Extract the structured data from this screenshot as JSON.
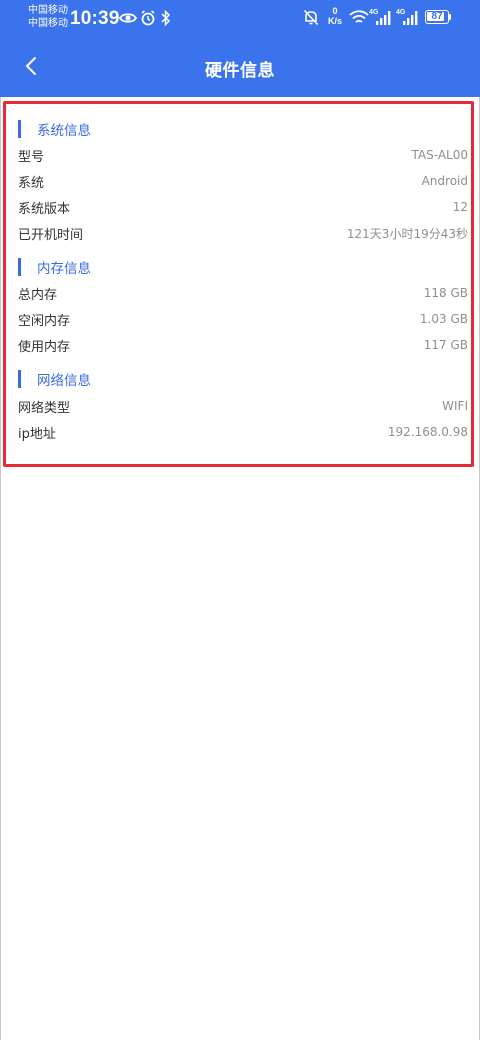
{
  "status_bar": {
    "carrier_1": "中国移动",
    "carrier_2": "中国移动",
    "time": "10:39",
    "net_speed_value": "0",
    "net_speed_unit": "K/s",
    "signal_1_label": "4G",
    "signal_2_label": "4G",
    "battery": "87",
    "battery_level": 0.87,
    "icons": [
      "eye-icon",
      "alarm-icon",
      "bluetooth-icon",
      "mute-icon",
      "wifi-icon",
      "signal-icon",
      "battery-icon"
    ]
  },
  "header": {
    "title": "硬件信息",
    "back_icon": "chevron-left-icon",
    "background_color": "#3a73ec"
  },
  "sections": [
    {
      "title": "系统信息",
      "rows": [
        {
          "label": "型号",
          "value": "TAS-AL00"
        },
        {
          "label": "系统",
          "value": "Android"
        },
        {
          "label": "系统版本",
          "value": "12"
        },
        {
          "label": "已开机时间",
          "value": "121天3小时19分43秒"
        }
      ]
    },
    {
      "title": "内存信息",
      "rows": [
        {
          "label": "总内存",
          "value": "118 GB"
        },
        {
          "label": "空闲内存",
          "value": "1.03 GB"
        },
        {
          "label": "使用内存",
          "value": "117 GB"
        }
      ]
    },
    {
      "title": "网络信息",
      "rows": [
        {
          "label": "网络类型",
          "value": "WIFI"
        },
        {
          "label": "ip地址",
          "value": "192.168.0.98"
        }
      ]
    }
  ],
  "colors": {
    "accent": "#3a6ae6",
    "highlight_border": "#e52a3a",
    "value_text": "#8f8f8f"
  }
}
